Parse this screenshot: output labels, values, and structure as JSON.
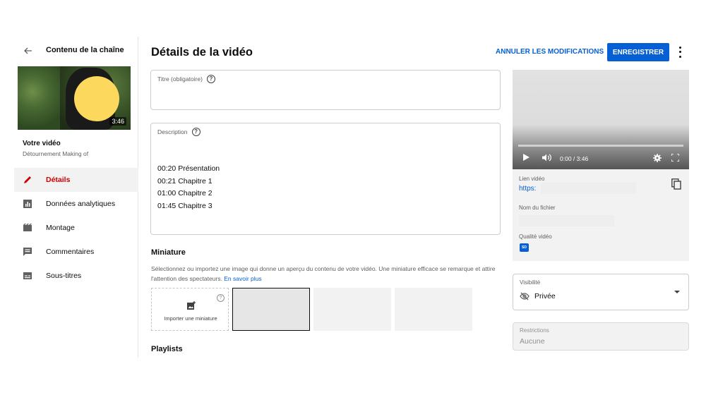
{
  "sidebar": {
    "back_label": "Contenu de la chaîne",
    "thumbnail_duration": "3:46",
    "video_heading": "Votre vidéo",
    "video_name": "Détournement Making of",
    "items": [
      {
        "label": "Détails",
        "icon": "pencil-icon",
        "active": true
      },
      {
        "label": "Données analytiques",
        "icon": "analytics-icon"
      },
      {
        "label": "Montage",
        "icon": "clapper-icon"
      },
      {
        "label": "Commentaires",
        "icon": "comment-icon"
      },
      {
        "label": "Sous-titres",
        "icon": "subtitles-icon"
      }
    ]
  },
  "header": {
    "title": "Détails de la vidéo",
    "cancel_label": "ANNULER LES MODIFICATIONS",
    "save_label": "ENREGISTRER"
  },
  "form": {
    "title_label": "Titre (obligatoire)",
    "title_value": "",
    "description_label": "Description",
    "description_lines": [
      "00:20 Présentation",
      "00:21 Chapitre 1",
      "01:00 Chapitre 2",
      "01:45 Chapitre 3"
    ]
  },
  "thumbnail": {
    "heading": "Miniature",
    "description": "Sélectionnez ou importez une image qui donne un aperçu du contenu de votre vidéo. Une miniature efficace se remarque et attire l'attention des spectateurs.",
    "learn_more": "En savoir plus",
    "upload_label": "Importer une miniature"
  },
  "playlists": {
    "heading": "Playlists"
  },
  "preview": {
    "time": "0:00 / 3:46",
    "link_label": "Lien vidéo",
    "link_value": "https:",
    "filename_label": "Nom du fichier",
    "quality_label": "Qualité vidéo",
    "quality_badge": "SD"
  },
  "visibility": {
    "label": "Visibilité",
    "value": "Privée"
  },
  "restrictions": {
    "label": "Restrictions",
    "value": "Aucune"
  },
  "colors": {
    "accent": "#065fd4",
    "active_nav": "#cc0000",
    "thumbnail_face": "#fcd85d"
  }
}
